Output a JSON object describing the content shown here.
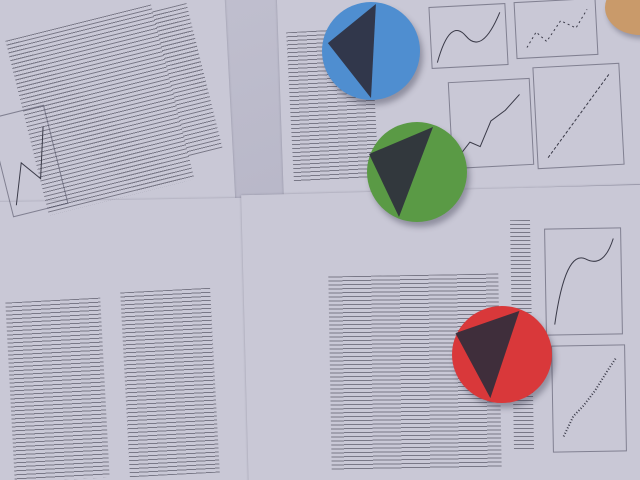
{
  "scene": {
    "description_free": true,
    "colors": {
      "paper": "#c9c8d6",
      "background": "#b4b3c2",
      "ink": "#3a3a48"
    }
  },
  "markers": [
    {
      "name": "blue-marker",
      "disc_color": "#4f8ed0",
      "triangle_color": "#2e2e3c"
    },
    {
      "name": "green-marker",
      "disc_color": "#5a9a45",
      "triangle_color": "#2e2e3c"
    },
    {
      "name": "red-marker",
      "disc_color": "#d9383a",
      "triangle_color": "#2e2e3c"
    }
  ]
}
